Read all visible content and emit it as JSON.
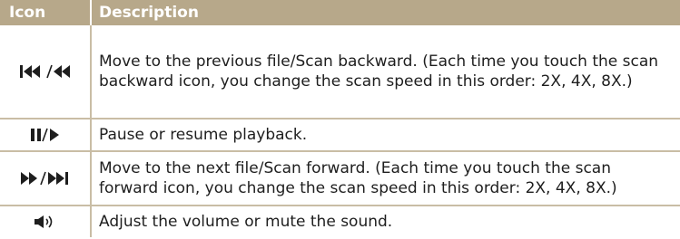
{
  "header": {
    "col_icon": "Icon",
    "col_description": "Description"
  },
  "rows": [
    {
      "icon": "skip-previous-rewind-icon",
      "description": "Move to the previous file/Scan backward. (Each time you touch the scan backward icon, you change the scan speed in this order: 2X, 4X, 8X.)"
    },
    {
      "icon": "pause-play-icon",
      "description": "Pause or resume playback."
    },
    {
      "icon": "fast-forward-skip-next-icon",
      "description": "Move to the next file/Scan forward. (Each time you touch the scan forward icon, you change the scan speed in this order: 2X, 4X, 8X.)"
    },
    {
      "icon": "volume-icon",
      "description": "Adjust the volume or mute the sound."
    }
  ],
  "colors": {
    "header_bg": "#b7a88a",
    "divider": "#c9bda5",
    "icon": "#1e1e1e"
  }
}
